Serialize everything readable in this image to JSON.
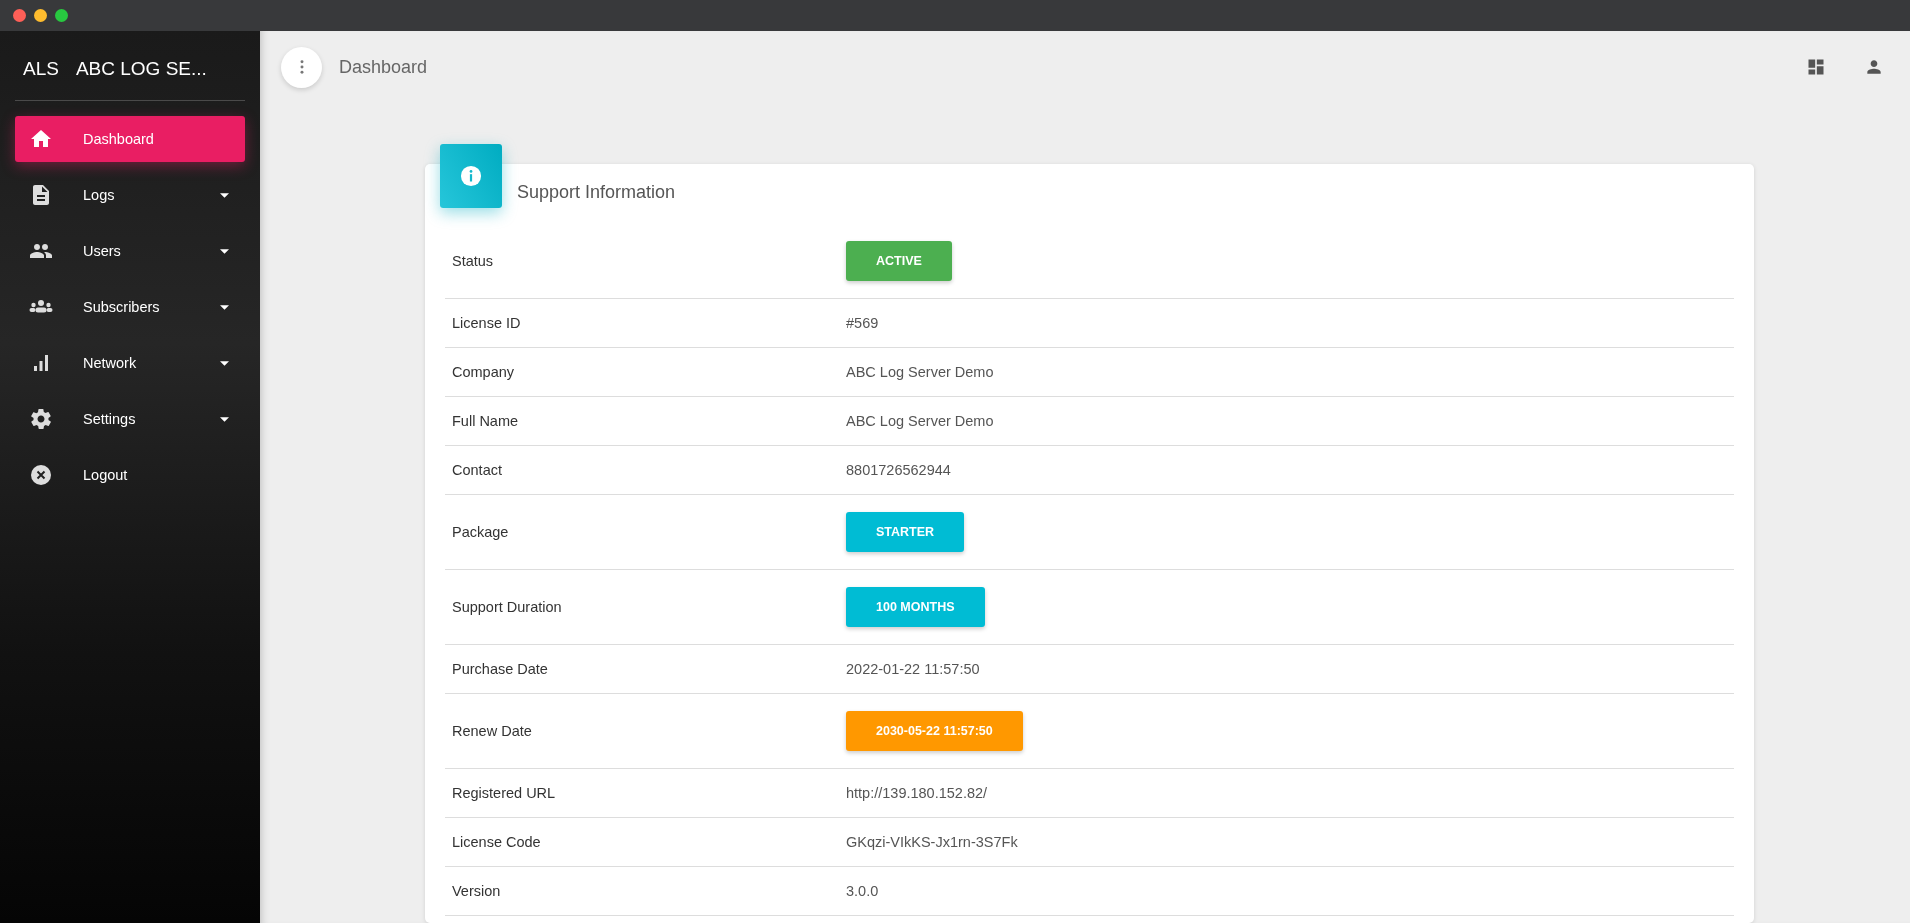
{
  "sidebar": {
    "brand_short": "ALS",
    "brand_name": "ABC LOG SE...",
    "items": [
      {
        "label": "Dashboard",
        "selected": true,
        "has_submenu": false
      },
      {
        "label": "Logs",
        "selected": false,
        "has_submenu": true
      },
      {
        "label": "Users",
        "selected": false,
        "has_submenu": true
      },
      {
        "label": "Subscribers",
        "selected": false,
        "has_submenu": true
      },
      {
        "label": "Network",
        "selected": false,
        "has_submenu": true
      },
      {
        "label": "Settings",
        "selected": false,
        "has_submenu": true
      },
      {
        "label": "Logout",
        "selected": false,
        "has_submenu": false
      }
    ]
  },
  "header": {
    "title": "Dashboard"
  },
  "card": {
    "title": "Support Information",
    "rows": [
      {
        "label": "Status",
        "kind": "badge",
        "value": "ACTIVE",
        "color": "#4caf50"
      },
      {
        "label": "License ID",
        "kind": "text",
        "value": "#569"
      },
      {
        "label": "Company",
        "kind": "text",
        "value": "ABC Log Server Demo"
      },
      {
        "label": "Full Name",
        "kind": "text",
        "value": "ABC Log Server Demo"
      },
      {
        "label": "Contact",
        "kind": "text",
        "value": "8801726562944"
      },
      {
        "label": "Package",
        "kind": "badge",
        "value": "STARTER",
        "color": "#00bcd4"
      },
      {
        "label": "Support Duration",
        "kind": "badge",
        "value": "100 MONTHS",
        "color": "#00bcd4"
      },
      {
        "label": "Purchase Date",
        "kind": "text",
        "value": "2022-01-22 11:57:50"
      },
      {
        "label": "Renew Date",
        "kind": "badge",
        "value": "2030-05-22 11:57:50",
        "color": "#ff9800"
      },
      {
        "label": "Registered URL",
        "kind": "text",
        "value": "http://139.180.152.82/"
      },
      {
        "label": "License Code",
        "kind": "text",
        "value": "GKqzi-VIkKS-Jx1rn-3S7Fk"
      },
      {
        "label": "Version",
        "kind": "text",
        "value": "3.0.0"
      }
    ]
  }
}
